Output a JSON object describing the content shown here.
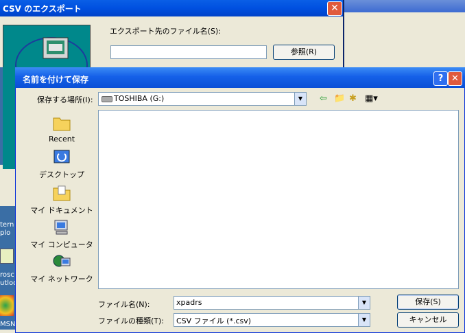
{
  "csv_window": {
    "title": "CSV のエクスポート",
    "close": "✕",
    "filename_label": "エクスポート先のファイル名(S):",
    "filename_value": "",
    "browse_label": "参照(R)"
  },
  "desktop": {
    "icons": [
      {
        "label": "tern"
      },
      {
        "label": "plo"
      },
      {
        "label": "rosc"
      },
      {
        "label": "utloo"
      },
      {
        "label": "MSN"
      }
    ]
  },
  "dialog": {
    "title": "名前を付けて保存",
    "help": "?",
    "close": "✕",
    "lookin_label": "保存する場所(I):",
    "lookin_value": "TOSHIBA (G:)",
    "places": [
      {
        "label": "Recent",
        "icon": "recent-folder-icon"
      },
      {
        "label": "デスクトップ",
        "icon": "desktop-icon"
      },
      {
        "label": "マイ ドキュメント",
        "icon": "my-documents-icon"
      },
      {
        "label": "マイ コンピュータ",
        "icon": "my-computer-icon"
      },
      {
        "label": "マイ ネットワーク",
        "icon": "my-network-icon"
      }
    ],
    "filename_label": "ファイル名(N):",
    "filename_value": "xpadrs",
    "filetype_label": "ファイルの種類(T):",
    "filetype_value": "CSV ファイル (*.csv)",
    "save_label": "保存(S)",
    "cancel_label": "キャンセル"
  }
}
